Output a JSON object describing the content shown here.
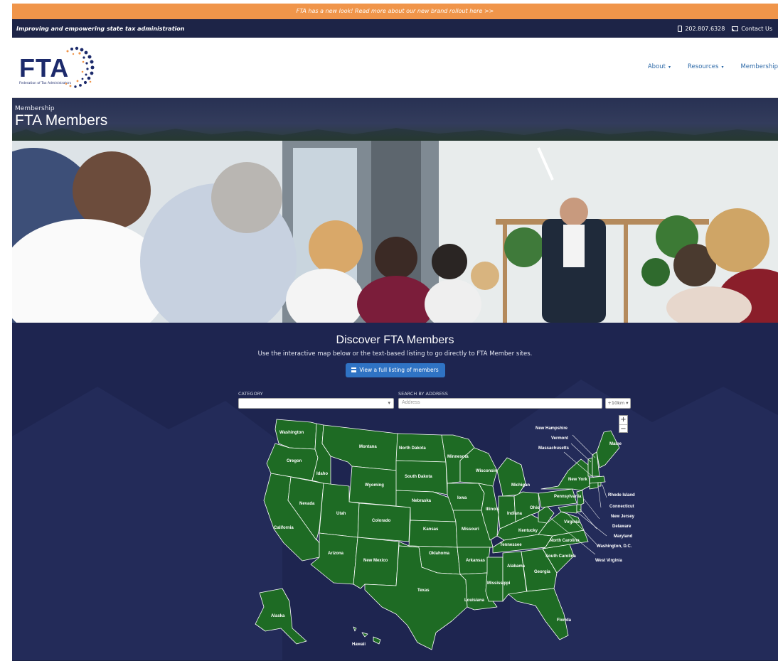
{
  "announcement": "FTA has a new look! Read more about our new brand rollout here >>",
  "utility": {
    "tagline": "Improving and empowering state tax administration",
    "phone": "202.807.6328",
    "contact": "Contact Us"
  },
  "logo": {
    "text": "FTA",
    "subtitle": "Federation of Tax Administrators"
  },
  "nav": {
    "about": "About",
    "resources": "Resources",
    "membership": "Membership"
  },
  "page": {
    "breadcrumb": "Membership",
    "title": "FTA Members"
  },
  "discover": {
    "heading": "Discover FTA Members",
    "subtitle": "Use the interactive map below or the text-based listing to go directly to FTA Member sites.",
    "button": "View a full listing of members",
    "category_label": "CATEGORY",
    "address_label": "SEARCH BY ADDRESS",
    "address_placeholder": "Address",
    "radius": "+10km",
    "zoom_in": "+",
    "zoom_out": "−"
  },
  "map": {
    "fill_color": "#1e6b24",
    "states": [
      "Washington",
      "Oregon",
      "California",
      "Nevada",
      "Idaho",
      "Montana",
      "Wyoming",
      "Utah",
      "Arizona",
      "Colorado",
      "New Mexico",
      "North Dakota",
      "South Dakota",
      "Nebraska",
      "Kansas",
      "Oklahoma",
      "Texas",
      "Minnesota",
      "Iowa",
      "Missouri",
      "Arkansas",
      "Louisiana",
      "Wisconsin",
      "Illinois",
      "Mississippi",
      "Michigan",
      "Indiana",
      "Kentucky",
      "Tennessee",
      "Alabama",
      "Ohio",
      "Georgia",
      "Florida",
      "South Carolina",
      "North Carolina",
      "Virginia",
      "West Virginia",
      "Pennsylvania",
      "New York",
      "Maine",
      "New Hampshire",
      "Vermont",
      "Massachusetts",
      "Rhode Island",
      "Connecticut",
      "New Jersey",
      "Delaware",
      "Maryland",
      "Washington, D.C.",
      "Alaska",
      "Hawaii"
    ]
  }
}
